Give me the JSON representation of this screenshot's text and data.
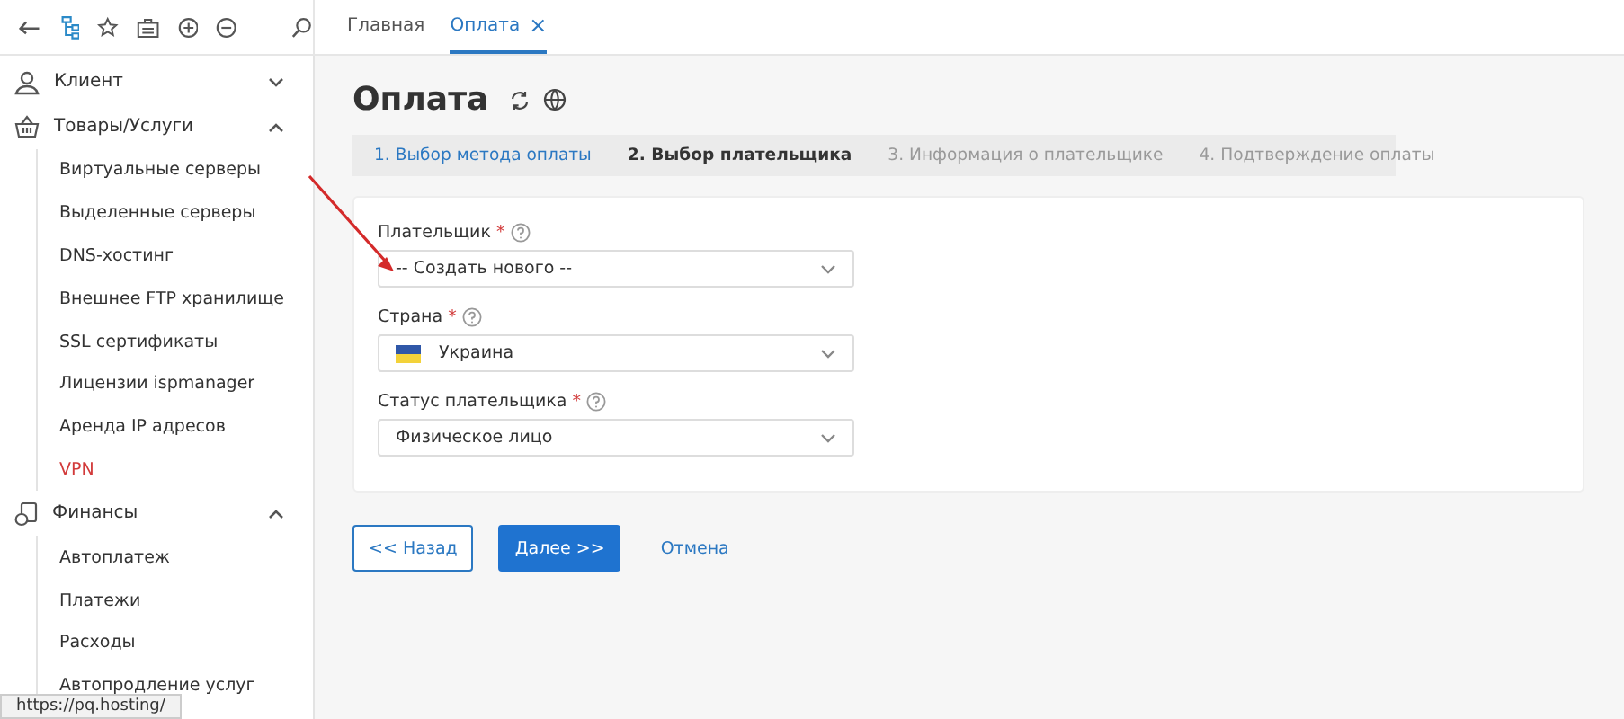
{
  "tabs": [
    {
      "label": "Главная",
      "selected": false
    },
    {
      "label": "Оплата",
      "selected": true,
      "close": "×"
    }
  ],
  "sidebar": {
    "groups": [
      {
        "label": "Клиент",
        "kind": "client",
        "expanded": false
      },
      {
        "label": "Товары/Услуги",
        "kind": "basket",
        "expanded": true,
        "children": [
          {
            "label": "Виртуальные серверы",
            "selected": false
          },
          {
            "label": "Выделенные серверы",
            "selected": false
          },
          {
            "label": "DNS-хостинг",
            "selected": false
          },
          {
            "label": "Внешнее FTP хранилище",
            "selected": false
          },
          {
            "label": "SSL сертификаты",
            "selected": false
          },
          {
            "label": "Лицензии ispmanager",
            "selected": false
          },
          {
            "label": "Аренда IP адресов",
            "selected": false
          },
          {
            "label": "VPN",
            "selected": true
          }
        ]
      },
      {
        "label": "Финансы",
        "kind": "finance",
        "expanded": true,
        "children": [
          {
            "label": "Автоплатеж",
            "selected": false
          },
          {
            "label": "Платежи",
            "selected": false
          },
          {
            "label": "Расходы",
            "selected": false
          },
          {
            "label": "Автопродление услуг",
            "selected": false
          }
        ]
      }
    ]
  },
  "page": {
    "title": "Оплата",
    "steps": [
      {
        "label": "1. Выбор метода оплаты",
        "done": true,
        "current": false
      },
      {
        "label": "2. Выбор плательщика",
        "done": false,
        "current": true
      },
      {
        "label": "3. Информация о плательщике",
        "done": false,
        "current": false
      },
      {
        "label": "4. Подтверждение оплаты",
        "done": false,
        "current": false
      }
    ],
    "fields": [
      {
        "label": "Плательщик",
        "required_mark": "*",
        "value": "-- Создать нового --",
        "kind": "select"
      },
      {
        "label": "Страна",
        "required_mark": "*",
        "value": "Украина",
        "kind": "country"
      },
      {
        "label": "Статус плательщика",
        "required_mark": "*",
        "value": "Физическое лицо",
        "kind": "select"
      }
    ],
    "buttons": [
      {
        "label": "<< Назад",
        "kind": "outline"
      },
      {
        "label": "Далее >>",
        "kind": "primary"
      },
      {
        "label": "Отмена",
        "kind": "link"
      }
    ]
  },
  "status_bar": {
    "url": "https://pq.hosting/"
  }
}
